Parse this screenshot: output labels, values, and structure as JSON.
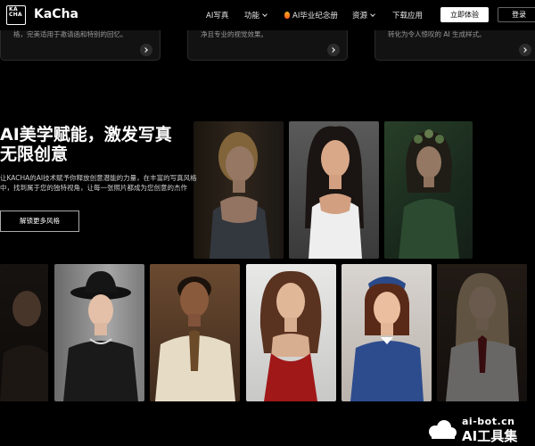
{
  "nav": {
    "logo_box_text": "KA\nCHA",
    "brand": "KaCha",
    "items": [
      "AI写真",
      "功能",
      "AI毕业纪念册",
      "资源",
      "下载应用"
    ],
    "experience_btn": "立即体验",
    "login_btn": "登录"
  },
  "cards": [
    {
      "text": "格，完美适用于邀请函和特别的回忆。"
    },
    {
      "text": "净且专业的视觉效果。"
    },
    {
      "text": "转化为令人惊叹的 AI 生成样式。"
    }
  ],
  "hero": {
    "title_line1": "AI美学赋能，激发写真",
    "title_line2": "无限创意",
    "description": "让KACHA的AI技术赋予你释放创意潜能的力量，在丰富的写真风格中，找到属于您的独特视角，让每一张照片都成为您创意的杰作",
    "button": "解锁更多风格"
  },
  "photos": [
    {
      "name": "blonde-woman-gray-top"
    },
    {
      "name": "dark-hair-woman-white-tank"
    },
    {
      "name": "fairy-woman-green-dress"
    },
    {
      "name": "woman-dark-partial"
    },
    {
      "name": "woman-black-hat"
    },
    {
      "name": "man-cream-suit"
    },
    {
      "name": "woman-red-dress"
    },
    {
      "name": "flight-attendant"
    },
    {
      "name": "blonde-schoolgirl"
    }
  ],
  "watermark": {
    "url": "ai-bot.cn",
    "name": "AI工具集"
  },
  "colors": {
    "background": "#000000",
    "button_white": "#ffffff",
    "card_bg": "#121212"
  }
}
